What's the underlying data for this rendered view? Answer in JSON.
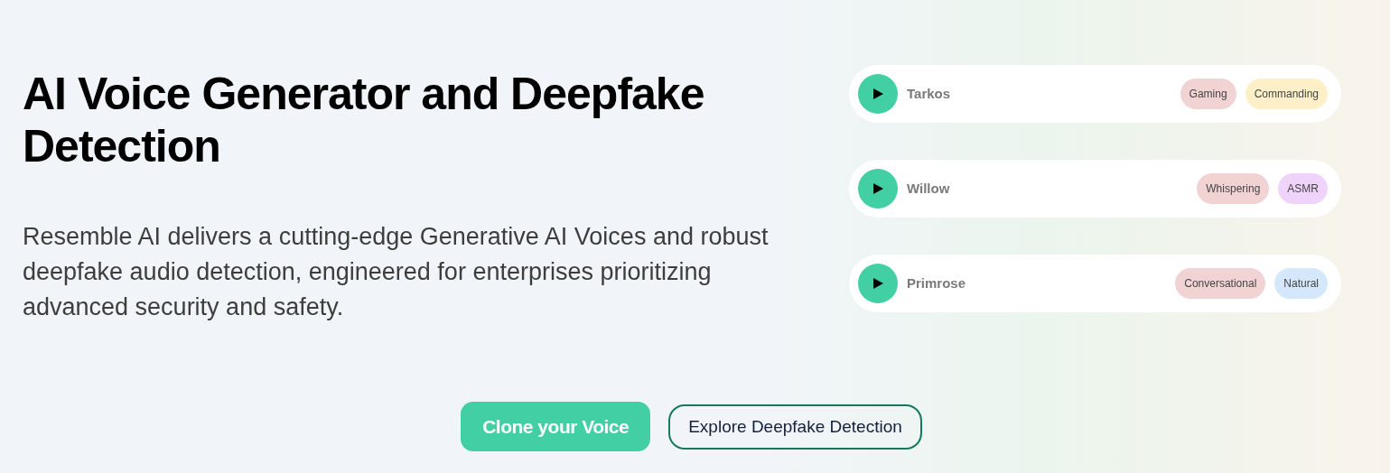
{
  "hero": {
    "title": "AI Voice Generator and Deepfake Detection",
    "description": "Resemble AI delivers a cutting-edge Generative AI Voices and robust deepfake audio detection, engineered for enterprises prioritizing advanced security and safety."
  },
  "voices": [
    {
      "name": "Tarkos",
      "tags": [
        {
          "label": "Gaming",
          "color": "#f2d3d3"
        },
        {
          "label": "Commanding",
          "color": "#fdf0c8"
        }
      ]
    },
    {
      "name": "Willow",
      "tags": [
        {
          "label": "Whispering",
          "color": "#f2d3d3"
        },
        {
          "label": "ASMR",
          "color": "#f0d3fb"
        }
      ]
    },
    {
      "name": "Primrose",
      "tags": [
        {
          "label": "Conversational",
          "color": "#f2d3d3"
        },
        {
          "label": "Natural",
          "color": "#d5e8fb"
        }
      ]
    }
  ],
  "buttons": [
    {
      "label": "Clone your Voice",
      "kind": "primary"
    },
    {
      "label": "Explore Deepfake Detection",
      "kind": "outline"
    }
  ]
}
